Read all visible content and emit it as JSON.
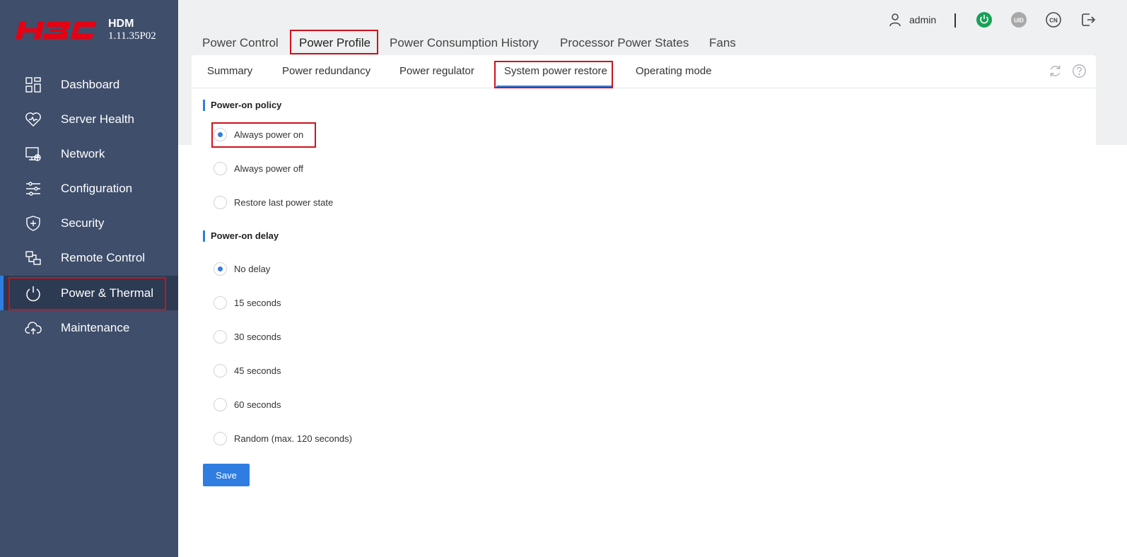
{
  "app": {
    "logo_text": "H3C",
    "name": "HDM",
    "version": "1.11.35P02"
  },
  "sidebar": {
    "items": [
      {
        "label": "Dashboard",
        "icon": "dashboard-icon"
      },
      {
        "label": "Server Health",
        "icon": "heart-icon"
      },
      {
        "label": "Network",
        "icon": "network-icon"
      },
      {
        "label": "Configuration",
        "icon": "sliders-icon"
      },
      {
        "label": "Security",
        "icon": "shield-icon"
      },
      {
        "label": "Remote Control",
        "icon": "remote-control-icon"
      },
      {
        "label": "Power & Thermal",
        "icon": "power-icon",
        "active": true
      },
      {
        "label": "Maintenance",
        "icon": "cloud-upload-icon"
      }
    ]
  },
  "header": {
    "user": "admin",
    "icons": [
      "user-icon",
      "power-status-icon",
      "uid-icon",
      "language-icon",
      "logout-icon"
    ],
    "uid_label": "UID",
    "lang_label": "CN"
  },
  "main_tabs": [
    {
      "label": "Power Control"
    },
    {
      "label": "Power Profile",
      "active": true
    },
    {
      "label": "Power Consumption History"
    },
    {
      "label": "Processor Power States"
    },
    {
      "label": "Fans"
    }
  ],
  "sub_tabs": [
    {
      "label": "Summary"
    },
    {
      "label": "Power redundancy"
    },
    {
      "label": "Power regulator"
    },
    {
      "label": "System power restore",
      "active": true
    },
    {
      "label": "Operating mode"
    }
  ],
  "power_on_policy": {
    "title": "Power-on policy",
    "options": [
      {
        "label": "Always power on",
        "checked": true
      },
      {
        "label": "Always power off",
        "checked": false
      },
      {
        "label": "Restore last power state",
        "checked": false
      }
    ]
  },
  "power_on_delay": {
    "title": "Power-on delay",
    "options": [
      {
        "label": "No delay",
        "checked": true
      },
      {
        "label": "15 seconds",
        "checked": false
      },
      {
        "label": "30 seconds",
        "checked": false
      },
      {
        "label": "45 seconds",
        "checked": false
      },
      {
        "label": "60 seconds",
        "checked": false
      },
      {
        "label": "Random (max. 120 seconds)",
        "checked": false
      }
    ]
  },
  "save_label": "Save",
  "colors": {
    "sidebar_bg": "#3e4e6b",
    "accent": "#2f7de1",
    "highlight_box": "#d0111b",
    "logo_red": "#e60012",
    "power_green": "#18a058"
  }
}
